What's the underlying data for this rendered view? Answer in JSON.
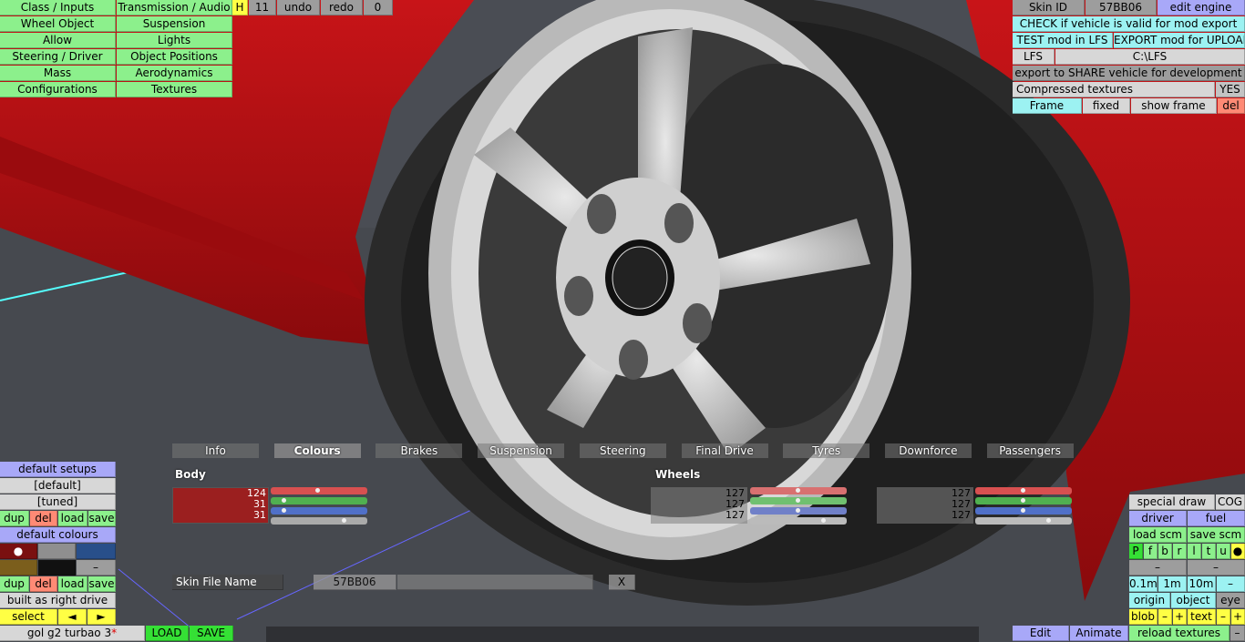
{
  "left_menu": {
    "rows": [
      [
        "Class / Inputs",
        "Transmission / Audio"
      ],
      [
        "Wheel Object",
        "Suspension"
      ],
      [
        "Allow",
        "Lights"
      ],
      [
        "Steering / Driver",
        "Object Positions"
      ],
      [
        "Mass",
        "Aerodynamics"
      ],
      [
        "Configurations",
        "Textures"
      ]
    ],
    "h_label": "H",
    "h_value": "11",
    "undo": "undo",
    "redo": "redo",
    "undo_count": "0"
  },
  "right_panel": {
    "skin_id_label": "Skin ID",
    "skin_id_value": "57BB06",
    "edit_engine": "edit engine",
    "check_valid": "CHECK if vehicle is valid for mod export",
    "test_mod": "TEST mod in LFS",
    "export_mod": "EXPORT mod for UPLOAD",
    "lfs_label": "LFS",
    "lfs_path": "C:\\LFS",
    "export_share": "export to SHARE vehicle for development",
    "compressed_label": "Compressed textures",
    "compressed_value": "YES",
    "frame": "Frame",
    "fixed": "fixed",
    "show_frame": "show frame",
    "del": "del"
  },
  "tabs": [
    "Info",
    "Colours",
    "Brakes",
    "Suspension",
    "Steering",
    "Final Drive",
    "Tyres",
    "Downforce",
    "Passengers"
  ],
  "active_tab": "Colours",
  "colours": {
    "body_label": "Body",
    "body": {
      "r": "124",
      "g": "31",
      "b": "31",
      "hex": "#9b1f1f",
      "r_frac": 0.49,
      "g_frac": 0.12,
      "b_frac": 0.12
    },
    "wheels_label": "Wheels",
    "wheels": {
      "r": "127",
      "g": "127",
      "b": "127",
      "r_frac": 0.5,
      "g_frac": 0.5,
      "b_frac": 0.5
    },
    "third": {
      "r": "127",
      "g": "127",
      "b": "127",
      "r_frac": 0.5,
      "g_frac": 0.5,
      "b_frac": 0.5
    }
  },
  "skin_file": {
    "label": "Skin File Name",
    "value": "57BB06",
    "clear": "X"
  },
  "left_bottom": {
    "default_setups": "default setups",
    "default_item": "[default]",
    "tuned_item": "[tuned]",
    "dup": "dup",
    "del": "del",
    "load": "load",
    "save": "save",
    "default_colours": "default colours",
    "swatch_dot": "●",
    "swatch_minus": "–",
    "dup2": "dup",
    "del2": "del",
    "load2": "load",
    "save2": "save",
    "built_right": "built as right drive",
    "select": "select",
    "arrow_left": "◄",
    "arrow_right": "►"
  },
  "bottom_bar": {
    "car_name": "gol g2 turbao 3",
    "asterisk": "*",
    "load": "LOAD",
    "save": "SAVE",
    "edit": "Edit",
    "animate": "Animate",
    "reload_textures": "reload textures",
    "minus": "–"
  },
  "right_bottom": {
    "special_draw": "special draw",
    "cog": "COG",
    "driver": "driver",
    "fuel": "fuel",
    "load_scm": "load scm",
    "save_scm": "save scm",
    "letters": [
      "P",
      "f",
      "b",
      "r",
      "l",
      "t",
      "u",
      "●"
    ],
    "dash1": "–",
    "dash2": "–",
    "scale_01": "0.1m",
    "scale_1": "1m",
    "scale_10": "10m",
    "scale_minus": "–",
    "origin": "origin",
    "object": "object",
    "eye": "eye",
    "blob": "blob",
    "blob_minus": "–",
    "blob_plus": "+",
    "text": "text",
    "text_minus": "–",
    "text_plus": "+"
  },
  "scene": {
    "body_color": "#b40e12",
    "rim_color": "#c9c9c9",
    "tyre_color": "#252525",
    "background_color": "#4a4d54"
  }
}
